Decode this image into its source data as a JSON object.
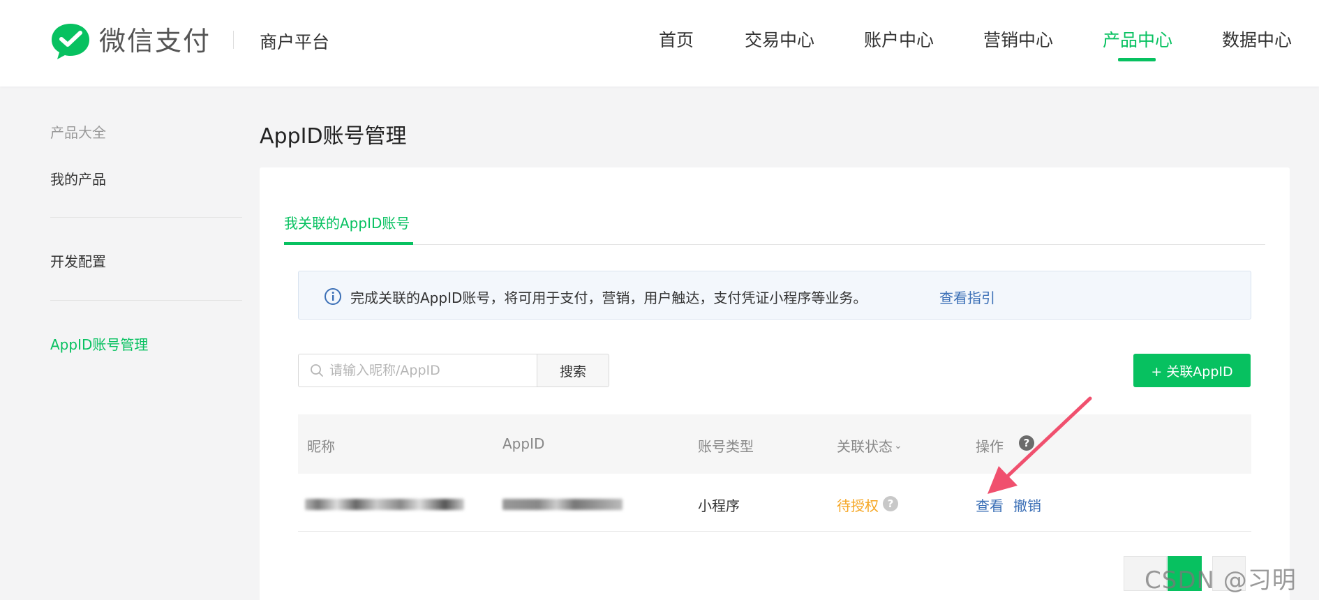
{
  "header": {
    "logo_text": "微信支付",
    "platform": "商户平台",
    "nav": [
      {
        "label": "首页",
        "active": false
      },
      {
        "label": "交易中心",
        "active": false
      },
      {
        "label": "账户中心",
        "active": false
      },
      {
        "label": "营销中心",
        "active": false
      },
      {
        "label": "产品中心",
        "active": true
      },
      {
        "label": "数据中心",
        "active": false
      }
    ]
  },
  "sidebar": {
    "items": [
      {
        "label": "产品大全",
        "state": "muted"
      },
      {
        "label": "我的产品",
        "state": "normal"
      },
      {
        "label": "开发配置",
        "state": "normal"
      },
      {
        "label": "AppID账号管理",
        "state": "active"
      }
    ]
  },
  "main": {
    "title": "AppID账号管理",
    "tab_label": "我关联的AppID账号",
    "notice": {
      "text": "完成关联的AppID账号，将可用于支付，营销，用户触达，支付凭证小程序等业务。",
      "link": "查看指引"
    },
    "search": {
      "placeholder": "请输入昵称/AppID",
      "button": "搜索"
    },
    "add_button": "+ 关联AppID",
    "table": {
      "columns": [
        "昵称",
        "AppID",
        "账号类型",
        "关联状态",
        "操作"
      ],
      "status_caret": "⌄",
      "rows": [
        {
          "nickname": "",
          "appid": "",
          "type": "小程序",
          "status": "待授权",
          "actions": [
            "查看",
            "撤销"
          ]
        }
      ]
    }
  },
  "watermark": "CSDN @习明然",
  "colors": {
    "brand": "#07c160",
    "link": "#3b6fb6",
    "pending": "#f5a623",
    "arrow": "#f0506e"
  }
}
